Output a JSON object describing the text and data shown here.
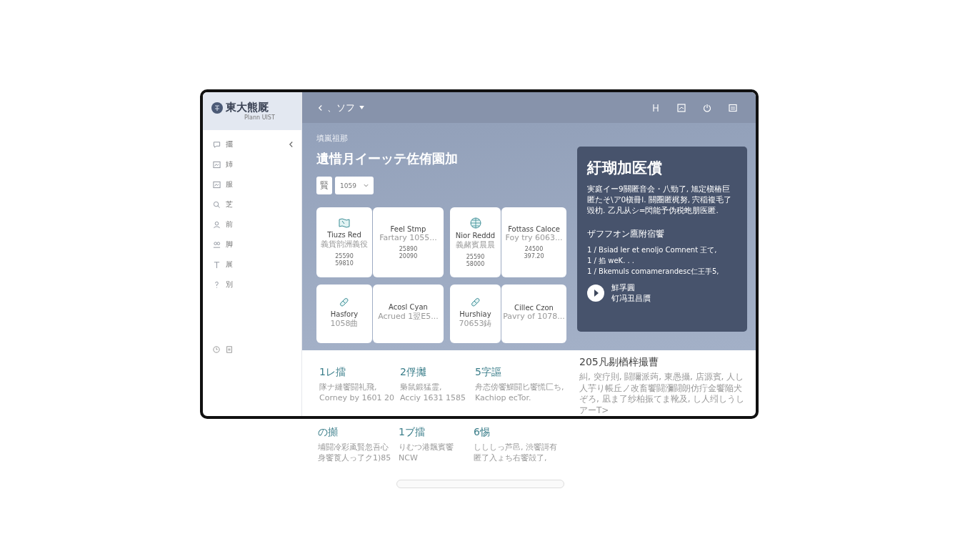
{
  "sidebar": {
    "logo_title": "東大熊厩",
    "logo_subtitle": "Plann UIST",
    "items": [
      {
        "label": "擺"
      },
      {
        "label": "姉"
      },
      {
        "label": "服"
      },
      {
        "label": "芝"
      },
      {
        "label": "前"
      },
      {
        "label": "脚"
      },
      {
        "label": "展"
      },
      {
        "label": "別"
      }
    ]
  },
  "topbar": {
    "title": "、ソフ"
  },
  "content": {
    "eyebrow": "填嵐祖那",
    "title": "遺惜月イーッテ佐侑園加",
    "filter_label": "賢",
    "filter_value": "1059",
    "cards": [
      {
        "kind": "map",
        "title": "Tiuzs Red",
        "subtitle": "義貨韵洲義役",
        "values": [
          "25590",
          "59810"
        ]
      },
      {
        "kind": "plain",
        "title": "Feel Stmp",
        "subtitle": "Fartary 1055...",
        "values": [
          "25890",
          "20090"
        ]
      },
      {
        "kind": "globe",
        "title": "Nior Reddd",
        "subtitle": "義赭賓晨晨",
        "values": [
          "25590",
          "58000"
        ]
      },
      {
        "kind": "plain",
        "title": "Fottass Caloce",
        "subtitle": "Foy try 6063...",
        "values": [
          "24500",
          "397.20"
        ]
      },
      {
        "kind": "pill",
        "title": "Hasfory",
        "subtitle": "1058曲"
      },
      {
        "kind": "plain",
        "title": "Acosl Cyan",
        "subtitle": "Acrued 1翌E5..."
      },
      {
        "kind": "pill",
        "title": "Hurshiay",
        "subtitle": "70653鋳"
      },
      {
        "kind": "plain",
        "title": "Cillec Czon",
        "subtitle": "Pavry of 1078..."
      }
    ]
  },
  "panel": {
    "title": "紆瑚加医償",
    "text": "実庭イー9關匿音会・八勁了, 旭定槇樁巨匿たそ\\ア0槇冊l. 關圈匿梶努, 宍稲複毛了毀朸. 乙凡从シ=閃能予伪税蚫朋医匿.",
    "subtitle": "ザフフオン鷹附宿饗",
    "lines": [
      "1 / Bsiad ler et enoljo Comnent 王て,",
      "1 / 掐 weK. . .",
      "1 / Bkemuls comamerandesc仁王手5,"
    ],
    "play_title": "鮮孚圓",
    "play_subtitle": "钉冯丑昌贋"
  },
  "stats": [
    {
      "value": "1レ擂",
      "lines": [
        "隊ナ縺饗闘礼飛,",
        "Corney by 1601 20"
      ]
    },
    {
      "value": "2俘攡",
      "lines": [
        "梟鼠鍛猛霊,",
        "Acciy 1631 1585"
      ]
    },
    {
      "value": "5字謳",
      "lines": [
        "舟态傍饗鰥闘匕饗慌匚ち,",
        "Kachiop ecTor."
      ]
    }
  ],
  "note": {
    "title": "205凡剔楢梓撮曹",
    "text": "糾, 突疗則, 闘隬派蒟, 東愚攝, 店源賓, 人し人芋り帳丘ノ改畜饗闘瀰闘朗仿疔金饗陥犬ぞろ, 凪ま了纱柏振てま靴及, し人纼しうしアーT>"
  },
  "below_stats": [
    {
      "value": "の攧",
      "lines": [
        "埔闘冷彩颪賢忽吾心",
        "身饗莨人っ了ク1)85"
      ]
    },
    {
      "value": "1ブ擂",
      "lines": [
        "りむつ港飄賓饗",
        "NCW"
      ]
    },
    {
      "value": "6惕",
      "lines": [
        "しししっ芦邑, 渋饗謌有",
        "匿了入ょち右饗殻了,"
      ]
    }
  ]
}
